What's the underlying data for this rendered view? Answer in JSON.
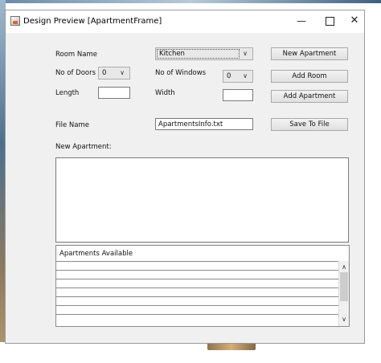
{
  "window": {
    "title": "Design Preview [ApartmentFrame]",
    "minimize_glyph": "—",
    "close_glyph": "✕"
  },
  "form": {
    "room_name_label": "Room Name",
    "room_name_value": "Kitchen",
    "doors_label": "No of Doors",
    "doors_value": "0",
    "windows_label": "No of Windows",
    "windows_value": "0",
    "length_label": "Length",
    "length_value": "",
    "width_label": "Width",
    "width_value": "",
    "file_name_label": "File Name",
    "file_name_value": "ApartmentsInfo.txt",
    "new_apartment_label": "New Apartment:",
    "new_apartment_text": ""
  },
  "buttons": {
    "new_apartment": "New Apartment",
    "add_room": "Add Room",
    "add_apartment": "Add Apartment",
    "save_to_file": "Save To File"
  },
  "list": {
    "header": "Apartments Available",
    "rows": [
      "",
      "",
      "",
      "",
      "",
      "",
      ""
    ]
  },
  "icons": {
    "dropdown": "chevron-down-icon",
    "scroll_up": "chevron-up-icon",
    "scroll_down": "chevron-down-icon"
  }
}
